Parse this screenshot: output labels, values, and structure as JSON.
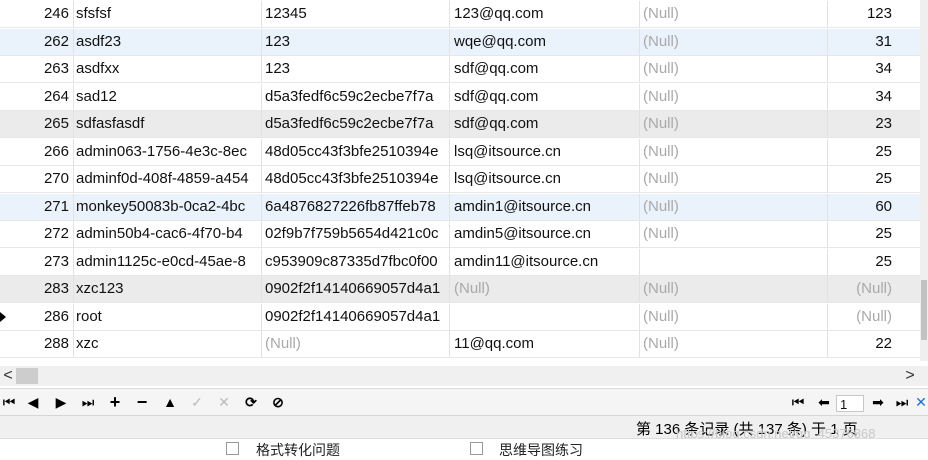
{
  "rows": [
    {
      "id": "246",
      "name": "sfsfsf",
      "pwd": "12345",
      "email": "123@qq.com",
      "col5": "(Null)",
      "col6": "123"
    },
    {
      "id": "262",
      "name": "asdf23",
      "pwd": "123",
      "email": "wqe@qq.com",
      "col5": "(Null)",
      "col6": "31"
    },
    {
      "id": "263",
      "name": "asdfxx",
      "pwd": "123",
      "email": "sdf@qq.com",
      "col5": "(Null)",
      "col6": "34"
    },
    {
      "id": "264",
      "name": "sad12",
      "pwd": "d5a3fedf6c59c2ecbe7f7a",
      "email": "sdf@qq.com",
      "col5": "(Null)",
      "col6": "34"
    },
    {
      "id": "265",
      "name": "sdfasfasdf",
      "pwd": "d5a3fedf6c59c2ecbe7f7a",
      "email": "sdf@qq.com",
      "col5": "(Null)",
      "col6": "23"
    },
    {
      "id": "266",
      "name": "admin063-1756-4e3c-8ec",
      "pwd": "48d05cc43f3bfe2510394e",
      "email": "lsq@itsource.cn",
      "col5": "(Null)",
      "col6": "25"
    },
    {
      "id": "270",
      "name": "adminf0d-408f-4859-a454",
      "pwd": "48d05cc43f3bfe2510394e",
      "email": "lsq@itsource.cn",
      "col5": "(Null)",
      "col6": "25"
    },
    {
      "id": "271",
      "name": "monkey50083b-0ca2-4bc",
      "pwd": "6a4876827226fb87ffeb78",
      "email": "amdin1@itsource.cn",
      "col5": "(Null)",
      "col6": "60"
    },
    {
      "id": "272",
      "name": "admin50b4-cac6-4f70-b4",
      "pwd": "02f9b7f759b5654d421c0c",
      "email": "amdin5@itsource.cn",
      "col5": "(Null)",
      "col6": "25"
    },
    {
      "id": "273",
      "name": "admin1125c-e0cd-45ae-8",
      "pwd": "c953909c87335d7fbc0f00",
      "email": "amdin11@itsource.cn",
      "col5": "",
      "col6": "25"
    },
    {
      "id": "283",
      "name": "xzc123",
      "pwd": "0902f2f14140669057d4a1",
      "email": "(Null)",
      "col5": "(Null)",
      "col6": "(Null)"
    },
    {
      "id": "286",
      "name": "root",
      "pwd": "0902f2f14140669057d4a1",
      "email": "",
      "col5": "(Null)",
      "col6": "(Null)"
    },
    {
      "id": "288",
      "name": "xzc",
      "pwd": "(Null)",
      "email": "11@qq.com",
      "col5": "(Null)",
      "col6": "22"
    }
  ],
  "row_tints": [
    "white",
    "blue",
    "white",
    "white",
    "gray",
    "white",
    "white",
    "blue",
    "white",
    "white",
    "gray",
    "white",
    "white"
  ],
  "current_row_index": 11,
  "toolbar": {
    "first_label": "⏮",
    "prev_label": "◀",
    "next_label": "▶",
    "last_label": "⏭",
    "add_label": "+",
    "delete_label": "−",
    "up_label": "▲",
    "apply_label": "✓",
    "discard_label": "✕",
    "refresh_label": "⟳",
    "stop_label": "⊘"
  },
  "pager": {
    "first_label": "⏮",
    "prev_label": "⬅",
    "page_value": "1",
    "next_label": "➡",
    "last_label": "⏭",
    "close_label": "✕"
  },
  "scroll": {
    "left_arrow": "<",
    "right_arrow": ">"
  },
  "status": {
    "text": "第 136 条记录 (共 137 条) 于 1 页",
    "watermark": "https://blog.csdn.net/qq_45376868"
  },
  "bottom_items": [
    {
      "label": "格式转化问题"
    },
    {
      "label": "思维导图练习"
    }
  ],
  "colors": {
    "grid_line": "#e7e7e7",
    "null_text": "#a9a9a9",
    "blue_row": "#eaf2fb",
    "gray_row": "#ebebeb"
  }
}
